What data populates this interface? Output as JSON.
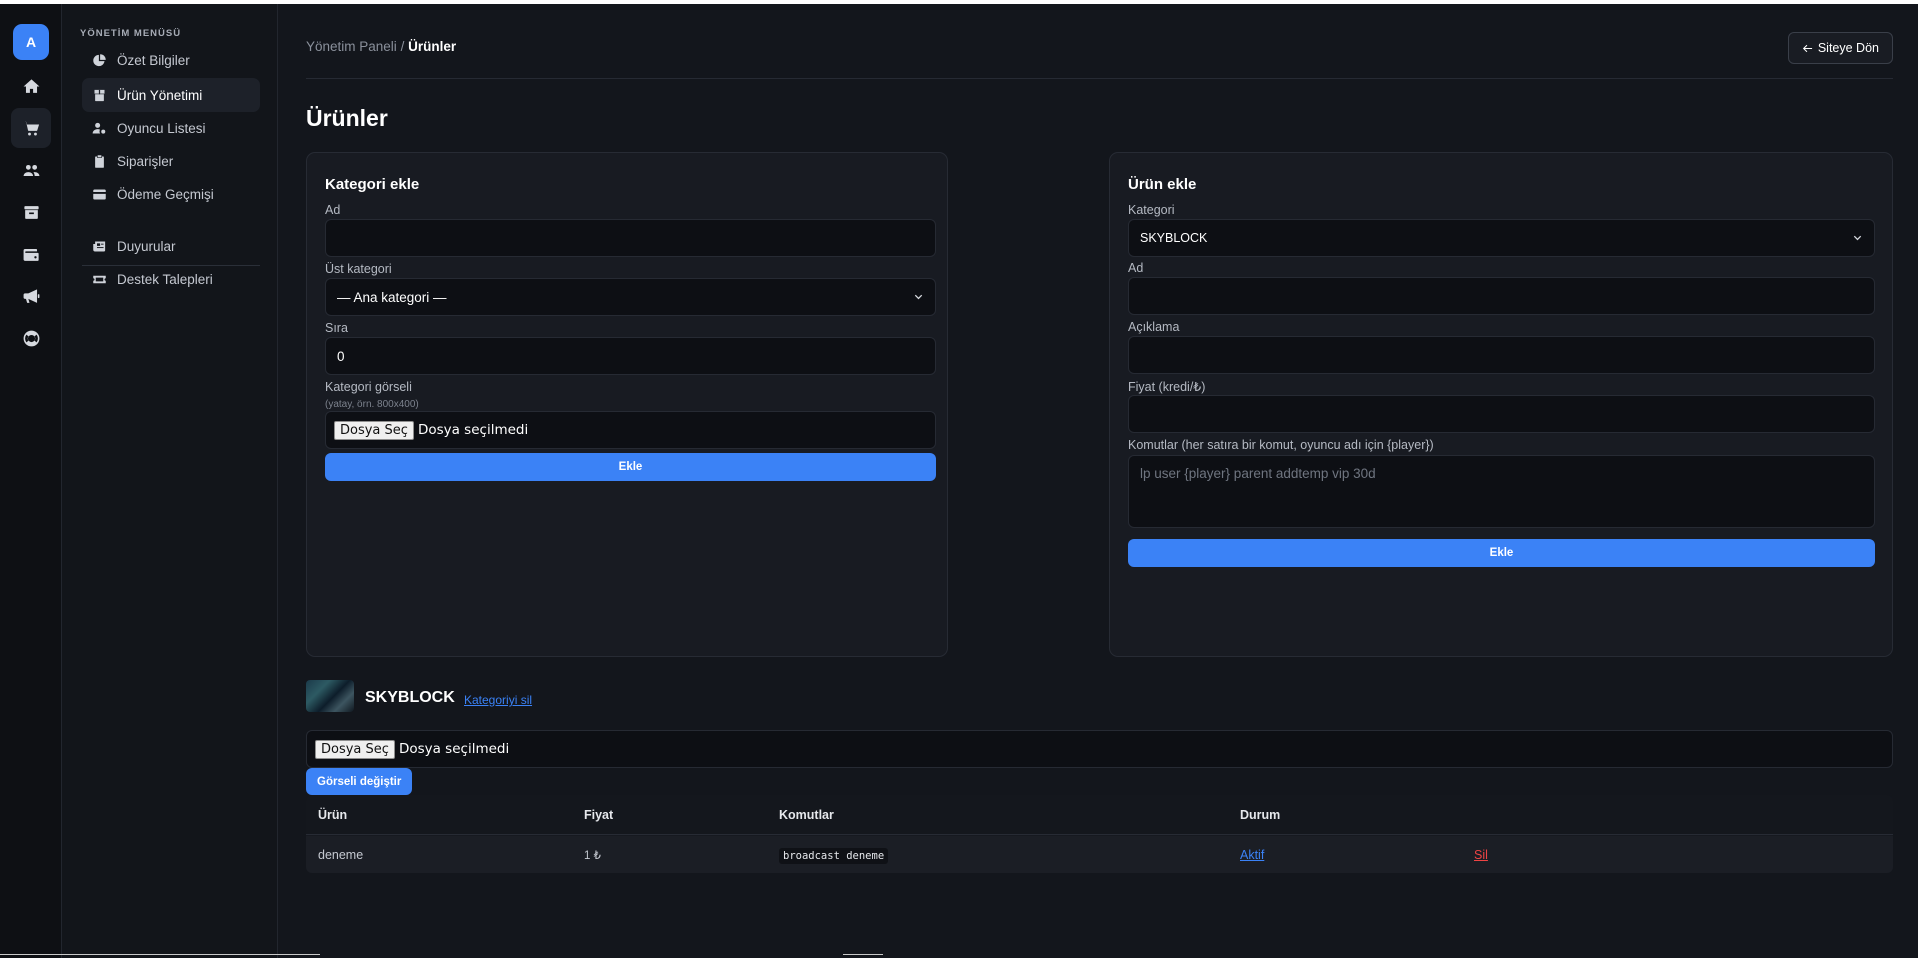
{
  "rail": {
    "avatar_letter": "A",
    "icons": [
      "home-icon",
      "cart-icon",
      "users-icon",
      "archive-icon",
      "wallet-icon",
      "bullhorn-icon",
      "lifering-icon"
    ]
  },
  "menu": {
    "title": "YÖNETİM MENÜSÜ",
    "items": [
      {
        "label": "Özet Bilgiler",
        "icon": "chart-pie-icon"
      },
      {
        "label": "Ürün Yönetimi",
        "icon": "box-icon"
      },
      {
        "label": "Oyuncu Listesi",
        "icon": "user-gear-icon"
      },
      {
        "label": "Siparişler",
        "icon": "clipboard-icon"
      },
      {
        "label": "Ödeme Geçmişi",
        "icon": "credit-card-icon"
      }
    ],
    "items2": [
      {
        "label": "Duyurular",
        "icon": "newspaper-icon"
      },
      {
        "label": "Destek Talepleri",
        "icon": "ticket-icon"
      }
    ]
  },
  "header": {
    "breadcrumb_root": "Yönetim Paneli",
    "breadcrumb_sep": "/",
    "breadcrumb_current": "Ürünler",
    "back_label": "Siteye Dön"
  },
  "page": {
    "title": "Ürünler"
  },
  "category_form": {
    "title": "Kategori ekle",
    "name_label": "Ad",
    "name_value": "",
    "parent_label": "Üst kategori",
    "parent_value": "— Ana kategori —",
    "order_label": "Sıra",
    "order_value": "0",
    "image_label": "Kategori görseli",
    "image_hint": "(yatay, örn. 800x400)",
    "file_button": "Dosya Seç",
    "file_status": "Dosya seçilmedi",
    "submit": "Ekle"
  },
  "product_form": {
    "title": "Ürün ekle",
    "category_label": "Kategori",
    "category_value": "SKYBLOCK",
    "name_label": "Ad",
    "name_value": "",
    "desc_label": "Açıklama",
    "desc_value": "",
    "price_label": "Fiyat (kredi/₺)",
    "price_value": "",
    "commands_label": "Komutlar (her satıra bir komut, oyuncu adı için {player})",
    "commands_placeholder": "lp user {player} parent addtemp vip 30d",
    "submit": "Ekle"
  },
  "category_section": {
    "name": "SKYBLOCK",
    "delete_link": "Kategoriyi sil",
    "file_button": "Dosya Seç",
    "file_status": "Dosya seçilmedi",
    "change_image": "Görseli değiştir"
  },
  "table": {
    "columns": [
      "Ürün",
      "Fiyat",
      "Komutlar",
      "Durum"
    ],
    "rows": [
      {
        "product": "deneme",
        "price": "1 ₺",
        "commands": "broadcast deneme",
        "status": "Aktif",
        "delete": "Sil"
      }
    ]
  }
}
